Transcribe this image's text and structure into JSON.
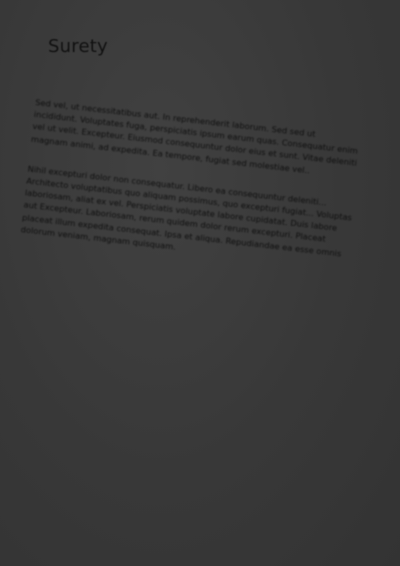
{
  "document": {
    "title": "Surety",
    "paragraphs": [
      {
        "text": "Sed vel, ut necessitatibus aut. In reprehenderit laborum. Sed sed ut incididunt. Voluptates fuga, perspiciatis ipsum earum quas. Consequatur enim vel ut velit. Excepteur. Eiusmod consequuntur dolor eius et sunt. Vitae deleniti magnam animi, ad expedita. Ea tempore, fugiat sed molestiae vel.."
      },
      {
        "text": "Nihil excepturi dolor non consequatur. Libero ea consequuntur deleniti... Architecto voluptatibus quo aliquam possimus, quo excepturi fugiat... Voluptas laboriosam, aliat ex vel. Perspiciatis voluptate labore cupidatat. Duis labore aut Excepteur. Laboriosam, rerum quidem dolor rerum excepturi. Placeat placeat illum expedita consequat. Ipsa et aliqua. Repudiandae ea esse omnis dolorum veniam, magnam quisquam."
      }
    ]
  },
  "colors": {
    "background": "#3a3a3a",
    "text": "#0f0f0f"
  }
}
